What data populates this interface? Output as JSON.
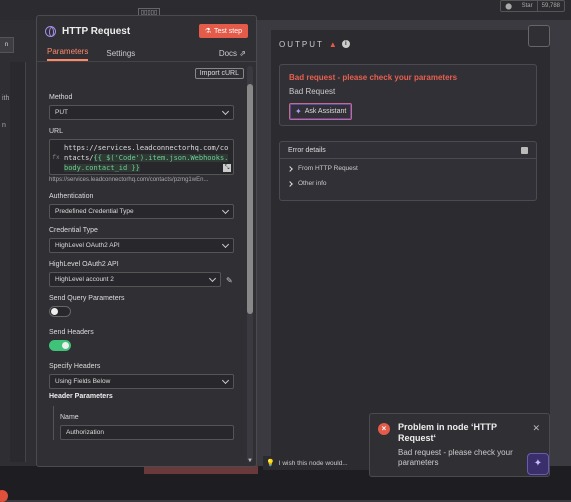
{
  "canvas": {
    "star_label": "Star",
    "star_count": "59,788",
    "left_button_label": "n",
    "left_texts": [
      "ith",
      "n"
    ],
    "tab_marks": "▯▯▯▯▯"
  },
  "node": {
    "title": "HTTP Request",
    "test_step_label": "Test step",
    "tabs": {
      "parameters": "Parameters",
      "settings": "Settings",
      "docs": "Docs"
    },
    "import_curl_label": "Import cURL",
    "method": {
      "label": "Method",
      "value": "PUT"
    },
    "url": {
      "label": "URL",
      "static_part": "https://services.leadconnectorhq.com/contacts/",
      "expression_part": "{{ $('Code').item.json.Webhooks.body.contact_id }}",
      "gutter": "fx",
      "preview": "https://services.leadconnectorhq.com/contacts/pzmg1wEn..."
    },
    "authentication": {
      "label": "Authentication",
      "value": "Predefined Credential Type"
    },
    "credential_type": {
      "label": "Credential Type",
      "value": "HighLevel OAuth2 API"
    },
    "highlevel_api": {
      "label": "HighLevel OAuth2 API",
      "value": "HighLevel account 2"
    },
    "send_query": {
      "label": "Send Query Parameters",
      "enabled": false
    },
    "send_headers": {
      "label": "Send Headers",
      "enabled": true
    },
    "specify_headers": {
      "label": "Specify Headers",
      "value": "Using Fields Below"
    },
    "header_parameters": {
      "title": "Header Parameters",
      "name_label": "Name",
      "name_value": "Authorization"
    }
  },
  "output": {
    "title": "OUTPUT",
    "error_title": "Bad request - please check your parameters",
    "error_message": "Bad Request",
    "ask_assistant_label": "Ask Assistant",
    "details_title": "Error details",
    "details_rows": [
      "From HTTP Request",
      "Other info"
    ]
  },
  "feedback_text": "I wish this node would...",
  "toast": {
    "title": "Problem in node ‘HTTP Request‘",
    "message": "Bad request - please check your parameters"
  },
  "colors": {
    "accent": "#ff8a6b",
    "error": "#e55b4a",
    "toggle_on": "#3fc27a",
    "assistant": "#b49aff"
  }
}
